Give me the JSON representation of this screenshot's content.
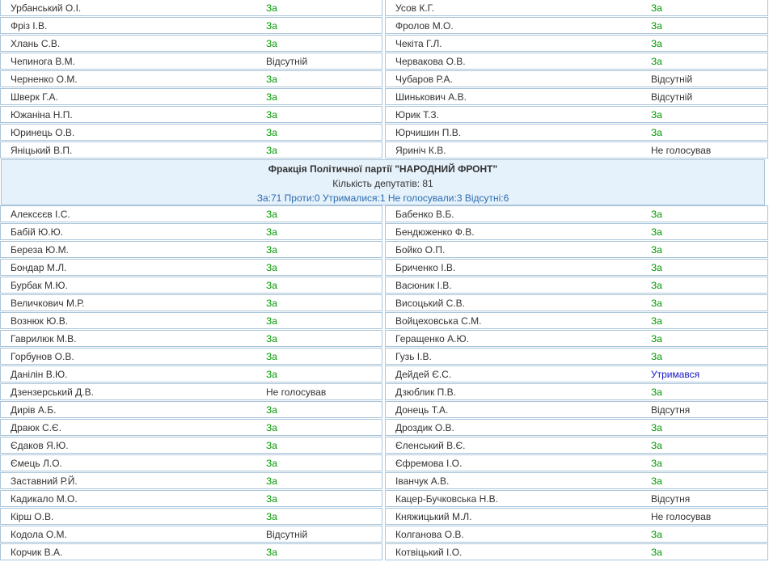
{
  "top_rows": [
    {
      "left": {
        "name": "Урбанський О.І.",
        "vote": "За",
        "type": "za"
      },
      "right": {
        "name": "Усов К.Г.",
        "vote": "За",
        "type": "za"
      }
    },
    {
      "left": {
        "name": "Фріз І.В.",
        "vote": "За",
        "type": "za"
      },
      "right": {
        "name": "Фролов М.О.",
        "vote": "За",
        "type": "za"
      }
    },
    {
      "left": {
        "name": "Хлань С.В.",
        "vote": "За",
        "type": "za"
      },
      "right": {
        "name": "Чекіта Г.Л.",
        "vote": "За",
        "type": "za"
      }
    },
    {
      "left": {
        "name": "Чепинога В.М.",
        "vote": "Відсутній",
        "type": "vid"
      },
      "right": {
        "name": "Червакова О.В.",
        "vote": "За",
        "type": "za"
      }
    },
    {
      "left": {
        "name": "Черненко О.М.",
        "vote": "За",
        "type": "za"
      },
      "right": {
        "name": "Чубаров Р.А.",
        "vote": "Відсутній",
        "type": "vid"
      }
    },
    {
      "left": {
        "name": "Шверк Г.А.",
        "vote": "За",
        "type": "za"
      },
      "right": {
        "name": "Шинькович А.В.",
        "vote": "Відсутній",
        "type": "vid"
      }
    },
    {
      "left": {
        "name": "Южаніна Н.П.",
        "vote": "За",
        "type": "za"
      },
      "right": {
        "name": "Юрик Т.З.",
        "vote": "За",
        "type": "za"
      }
    },
    {
      "left": {
        "name": "Юринець О.В.",
        "vote": "За",
        "type": "za"
      },
      "right": {
        "name": "Юрчишин П.В.",
        "vote": "За",
        "type": "za"
      }
    },
    {
      "left": {
        "name": "Яніцький В.П.",
        "vote": "За",
        "type": "za"
      },
      "right": {
        "name": "Яриніч К.В.",
        "vote": "Не голосував",
        "type": "ng"
      }
    }
  ],
  "faction": {
    "name": "Фракція Політичної партії \"НАРОДНИЙ ФРОНТ\"",
    "count": "Кількість депутатів: 81",
    "summary": "За:71 Проти:0 Утрималися:1 Не голосували:3 Відсутні:6"
  },
  "bottom_rows": [
    {
      "left": {
        "name": "Алексєєв І.С.",
        "vote": "За",
        "type": "za"
      },
      "right": {
        "name": "Бабенко В.Б.",
        "vote": "За",
        "type": "za"
      }
    },
    {
      "left": {
        "name": "Бабій Ю.Ю.",
        "vote": "За",
        "type": "za"
      },
      "right": {
        "name": "Бендюженко Ф.В.",
        "vote": "За",
        "type": "za"
      }
    },
    {
      "left": {
        "name": "Береза Ю.М.",
        "vote": "За",
        "type": "za"
      },
      "right": {
        "name": "Бойко О.П.",
        "vote": "За",
        "type": "za"
      }
    },
    {
      "left": {
        "name": "Бондар М.Л.",
        "vote": "За",
        "type": "za"
      },
      "right": {
        "name": "Бриченко І.В.",
        "vote": "За",
        "type": "za"
      }
    },
    {
      "left": {
        "name": "Бурбак М.Ю.",
        "vote": "За",
        "type": "za"
      },
      "right": {
        "name": "Васюник І.В.",
        "vote": "За",
        "type": "za"
      }
    },
    {
      "left": {
        "name": "Величкович М.Р.",
        "vote": "За",
        "type": "za"
      },
      "right": {
        "name": "Висоцький С.В.",
        "vote": "За",
        "type": "za"
      }
    },
    {
      "left": {
        "name": "Вознюк Ю.В.",
        "vote": "За",
        "type": "za"
      },
      "right": {
        "name": "Войцеховська С.М.",
        "vote": "За",
        "type": "za"
      }
    },
    {
      "left": {
        "name": "Гаврилюк М.В.",
        "vote": "За",
        "type": "za"
      },
      "right": {
        "name": "Геращенко А.Ю.",
        "vote": "За",
        "type": "za"
      }
    },
    {
      "left": {
        "name": "Горбунов О.В.",
        "vote": "За",
        "type": "za"
      },
      "right": {
        "name": "Гузь І.В.",
        "vote": "За",
        "type": "za"
      }
    },
    {
      "left": {
        "name": "Данілін В.Ю.",
        "vote": "За",
        "type": "za"
      },
      "right": {
        "name": "Дейдей Є.С.",
        "vote": "Утримався",
        "type": "ut"
      }
    },
    {
      "left": {
        "name": "Дзензерський Д.В.",
        "vote": "Не голосував",
        "type": "ng"
      },
      "right": {
        "name": "Дзюблик П.В.",
        "vote": "За",
        "type": "za"
      }
    },
    {
      "left": {
        "name": "Дирів А.Б.",
        "vote": "За",
        "type": "za"
      },
      "right": {
        "name": "Донець Т.А.",
        "vote": "Відсутня",
        "type": "vid"
      }
    },
    {
      "left": {
        "name": "Драюк С.Є.",
        "vote": "За",
        "type": "za"
      },
      "right": {
        "name": "Дроздик О.В.",
        "vote": "За",
        "type": "za"
      }
    },
    {
      "left": {
        "name": "Єдаков Я.Ю.",
        "vote": "За",
        "type": "za"
      },
      "right": {
        "name": "Єленський В.Є.",
        "vote": "За",
        "type": "za"
      }
    },
    {
      "left": {
        "name": "Ємець Л.О.",
        "vote": "За",
        "type": "za"
      },
      "right": {
        "name": "Єфремова І.О.",
        "vote": "За",
        "type": "za"
      }
    },
    {
      "left": {
        "name": "Заставний Р.Й.",
        "vote": "За",
        "type": "za"
      },
      "right": {
        "name": "Іванчук А.В.",
        "vote": "За",
        "type": "za"
      }
    },
    {
      "left": {
        "name": "Кадикало М.О.",
        "vote": "За",
        "type": "za"
      },
      "right": {
        "name": "Кацер-Бучковська Н.В.",
        "vote": "Відсутня",
        "type": "vid"
      }
    },
    {
      "left": {
        "name": "Кірш О.В.",
        "vote": "За",
        "type": "za"
      },
      "right": {
        "name": "Княжицький М.Л.",
        "vote": "Не голосував",
        "type": "ng"
      }
    },
    {
      "left": {
        "name": "Кодола О.М.",
        "vote": "Відсутній",
        "type": "vid"
      },
      "right": {
        "name": "Колганова О.В.",
        "vote": "За",
        "type": "za"
      }
    },
    {
      "left": {
        "name": "Корчик В.А.",
        "vote": "За",
        "type": "za"
      },
      "right": {
        "name": "Котвіцький І.О.",
        "vote": "За",
        "type": "za"
      }
    }
  ]
}
